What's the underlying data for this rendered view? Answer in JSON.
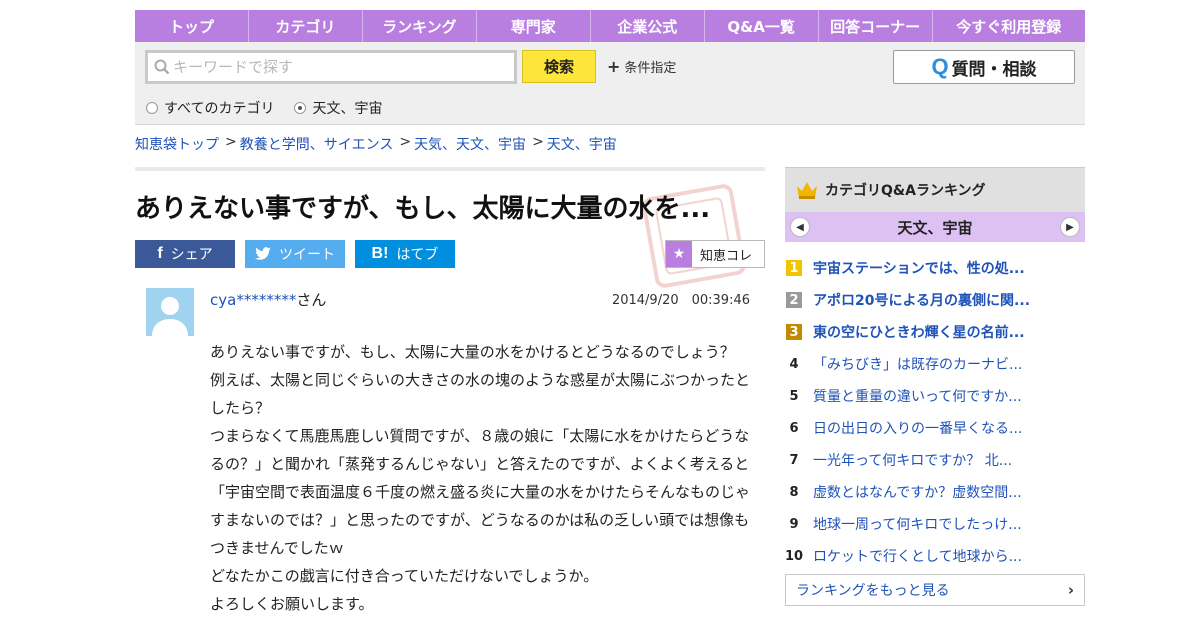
{
  "nav": [
    "トップ",
    "カテゴリ",
    "ランキング",
    "専門家",
    "企業公式",
    "Q&A一覧",
    "回答コーナー",
    "今すぐ利用登録"
  ],
  "search": {
    "placeholder": "キーワードで探す",
    "button": "検索",
    "condition": "条件指定",
    "ask_button": "質問・相談",
    "ask_icon": "Q",
    "radio_all": "すべてのカテゴリ",
    "radio_current": "天文、宇宙"
  },
  "breadcrumb": [
    "知恵袋トップ",
    "教養と学問、サイエンス",
    "天気、天文、宇宙",
    "天文、宇宙"
  ],
  "question": {
    "title": "ありえない事ですが、もし、太陽に大量の水を...",
    "share_facebook": "シェア",
    "share_twitter": "ツイート",
    "share_hatena": "はてブ",
    "hatena_icon": "B!",
    "chie_collect": "知恵コレ",
    "user": "cya********",
    "user_suffix": "さん",
    "datetime": "2014/9/20　00:39:46",
    "body": [
      "ありえない事ですが、もし、太陽に大量の水をかけるとどうなるのでしょう？",
      "例えば、太陽と同じぐらいの大きさの水の塊のような惑星が太陽にぶつかったとしたら？",
      "つまらなくて馬鹿馬鹿しい質問ですが、８歳の娘に「太陽に水をかけたらどうなるの？」と聞かれ「蒸発するんじゃない」と答えたのですが、よくよく考えると「宇宙空間で表面温度６千度の燃え盛る炎に大量の水をかけたらそんなものじゃすまないのでは？」と思ったのですが、どうなるのかは私の乏しい頭では想像もつきませんでしたｗ",
      "どなたかこの戯言に付き合っていただけないでしょうか。",
      "よろしくお願いします。"
    ]
  },
  "sidebar": {
    "heading": "カテゴリQ&Aランキング",
    "category": "天文、宇宙",
    "ranking": [
      {
        "rank": "1",
        "text": "宇宙ステーションでは、性の処..."
      },
      {
        "rank": "2",
        "text": "アポロ20号による月の裏側に関..."
      },
      {
        "rank": "3",
        "text": "東の空にひときわ輝く星の名前..."
      },
      {
        "rank": "4",
        "text": "「みちびき」は既存のカーナビ..."
      },
      {
        "rank": "5",
        "text": "質量と重量の違いって何ですか..."
      },
      {
        "rank": "6",
        "text": "日の出日の入りの一番早くなる..."
      },
      {
        "rank": "7",
        "text": "一光年って何キロですか？ 北..."
      },
      {
        "rank": "8",
        "text": "虚数とはなんですか？虚数空間..."
      },
      {
        "rank": "9",
        "text": "地球一周って何キロでしたっけ..."
      },
      {
        "rank": "10",
        "text": "ロケットで行くとして地球から..."
      }
    ],
    "more": "ランキングをもっと見る"
  },
  "colors": {
    "nav": "#b97fe0",
    "search_button": "#fde53a",
    "link": "#1f53b8",
    "facebook": "#3b5998",
    "twitter": "#55acee",
    "hatena": "#008fde"
  }
}
